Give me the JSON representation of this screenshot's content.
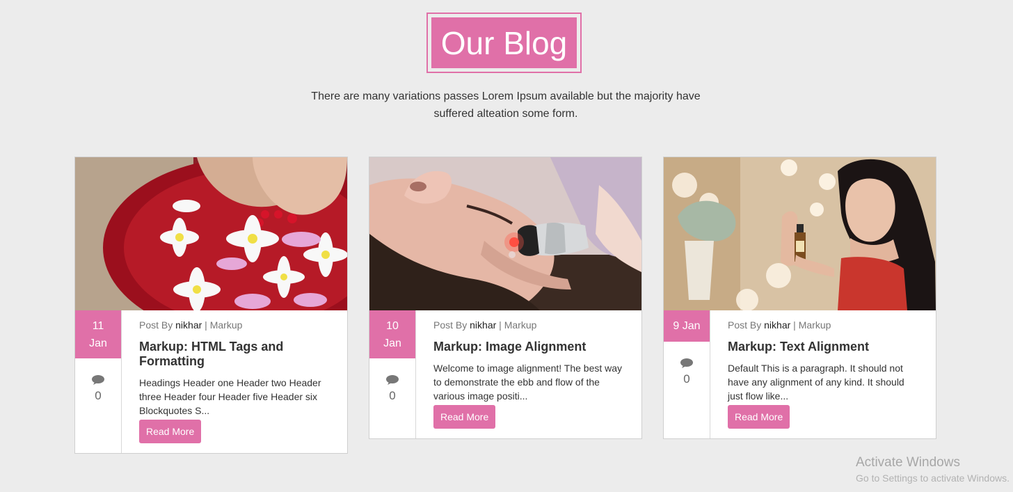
{
  "header": {
    "title": "Our Blog",
    "intro_line1": "There are many variations passes Lorem Ipsum available but the majority have",
    "intro_line2": "suffered alteation some form."
  },
  "posts": [
    {
      "day": "11",
      "month": "Jan",
      "meta_prefix": "Post By",
      "author": "nikhar",
      "separator": "|",
      "category": "Markup",
      "title": "Markup: HTML Tags and Formatting",
      "excerpt": "Headings Header one Header two Header three Header four Header five Header six Blockquotes S...",
      "read_more": "Read More",
      "comments": "0"
    },
    {
      "day": "10",
      "month": "Jan",
      "meta_prefix": "Post By",
      "author": "nikhar",
      "separator": "|",
      "category": "Markup",
      "title": "Markup: Image Alignment",
      "excerpt": "Welcome to image alignment! The best way to demonstrate the ebb and flow of the various image positi...",
      "read_more": "Read More",
      "comments": "0"
    },
    {
      "date": "9 Jan",
      "meta_prefix": "Post By",
      "author": "nikhar",
      "separator": "|",
      "category": "Markup",
      "title": "Markup: Text Alignment",
      "excerpt": "Default This is a paragraph. It should not have any alignment of any kind. It should just flow like...",
      "read_more": "Read More",
      "comments": "0"
    }
  ],
  "watermark": {
    "title": "Activate Windows",
    "subtitle": "Go to Settings to activate Windows."
  },
  "colors": {
    "accent": "#e070a8",
    "background": "#ececec"
  }
}
